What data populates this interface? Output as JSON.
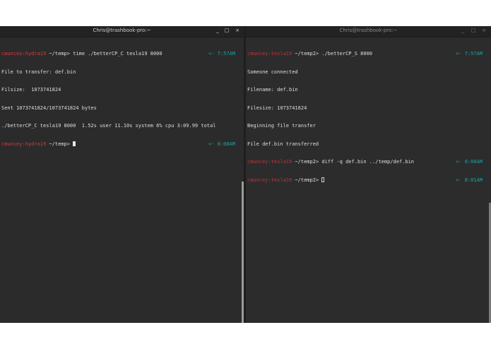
{
  "left": {
    "title": "Chris@trashbook-pro:~",
    "controls": {
      "minimize": "_",
      "maximize": "□",
      "close": "×"
    },
    "lines": [
      {
        "user": "cmuncey:hydra19",
        "path": " ~/temp",
        "prompt": "> ",
        "cmd": "time ./betterCP_C tesla19 8000",
        "time": "<- 7:57AM"
      },
      {
        "text": "File to transfer: def.bin"
      },
      {
        "text": "Filsize:  1073741824"
      },
      {
        "text": "Sent 1073741824/1073741824 bytes"
      },
      {
        "text": "./betterCP_C tesla19 8000  1.52s user 11.10s system 6% cpu 3:09.99 total"
      },
      {
        "user": "cmuncey:hydra19",
        "path": " ~/temp",
        "prompt": "> ",
        "cmd": "",
        "time": "<- 8:00AM",
        "cursor": "block"
      }
    ]
  },
  "right": {
    "title": "Chris@trashbook-pro:~",
    "controls": {
      "minimize": "_",
      "maximize": "□",
      "close": "×"
    },
    "lines": [
      {
        "user": "cmuncey:tesla19",
        "path": " ~/temp2",
        "prompt": "> ",
        "cmd": "./betterCP_S 8000",
        "time": "<- 7:57AM"
      },
      {
        "text": "Someone connected"
      },
      {
        "text": "Filename: def.bin"
      },
      {
        "text": "Filesize: 1073741824"
      },
      {
        "text": "Beginning file transfer"
      },
      {
        "text": "File def.bin transferred"
      },
      {
        "user": "cmuncey:tesla19",
        "path": " ~/temp2",
        "prompt": "> ",
        "cmd": "diff -q def.bin ../temp/def.bin",
        "time": "<- 8:00AM"
      },
      {
        "user": "cmuncey:tesla19",
        "path": " ~/temp2",
        "prompt": "> ",
        "cmd": "",
        "time": "<- 8:01AM",
        "cursor": "outline"
      }
    ]
  }
}
